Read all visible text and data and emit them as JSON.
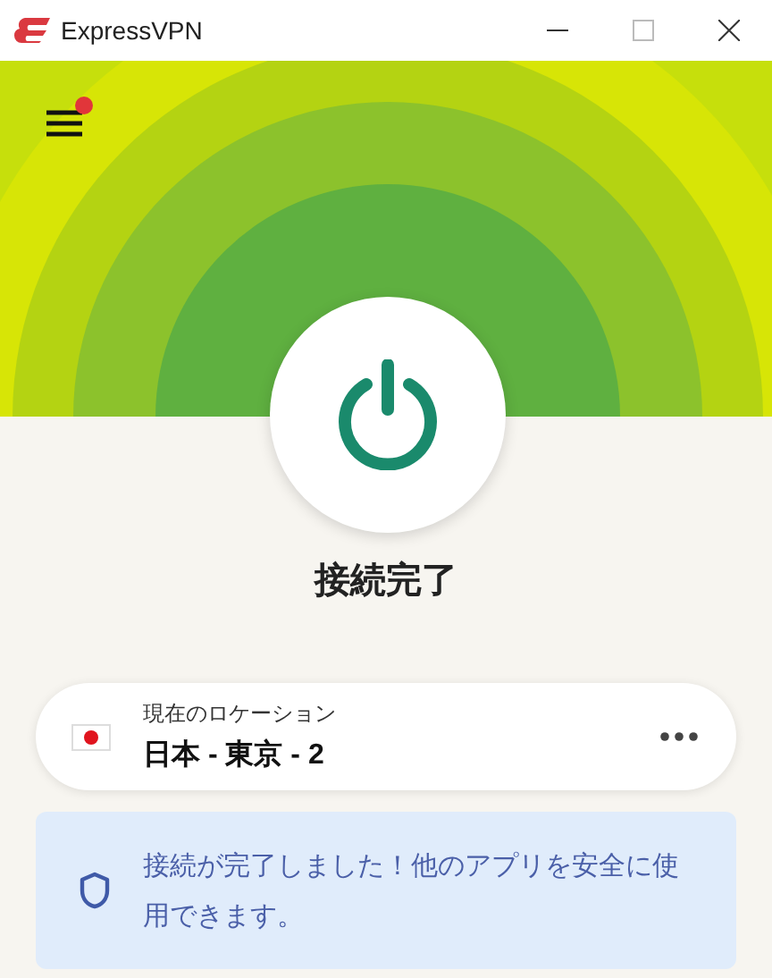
{
  "window": {
    "title": "ExpressVPN"
  },
  "menu": {
    "has_notification": true
  },
  "connection": {
    "connected": true,
    "status": "接続完了"
  },
  "location": {
    "label": "現在のロケーション",
    "name": "日本 - 東京 - 2"
  },
  "notice": {
    "text": "接続が完了しました！他のアプリを安全に使用できます。"
  }
}
